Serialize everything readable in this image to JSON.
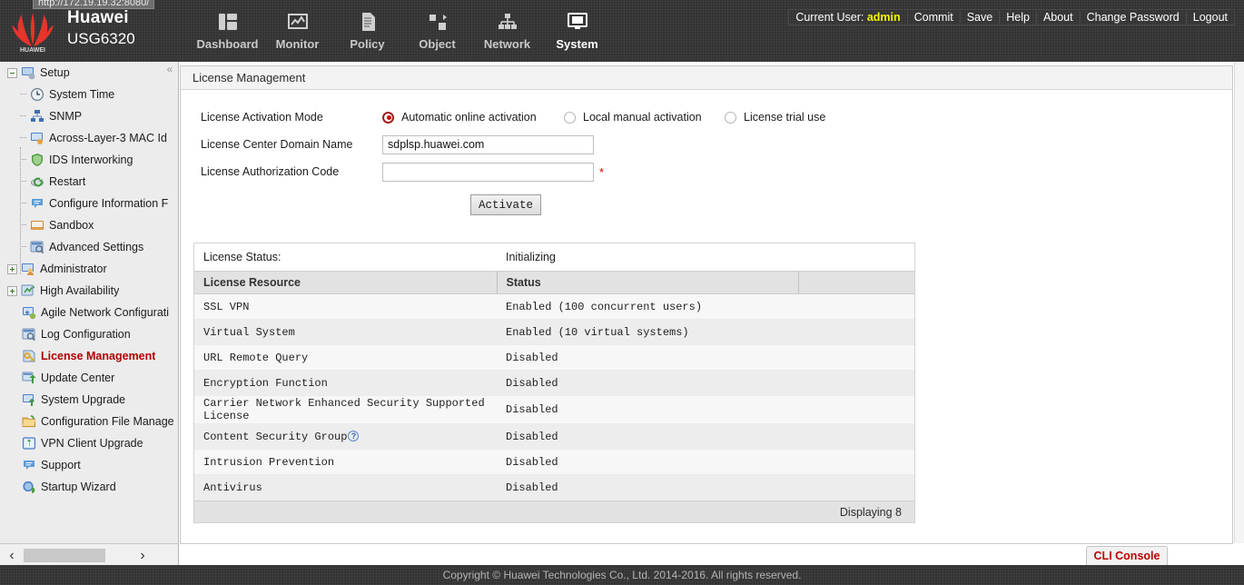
{
  "browser": {
    "url_tip": "http://172.19.19.32:8080/"
  },
  "header": {
    "brand_name": "Huawei",
    "model": "USG6320",
    "logo_text": "HUAWEI",
    "nav": [
      {
        "label": "Dashboard",
        "icon": "dashboard-icon",
        "active": false
      },
      {
        "label": "Monitor",
        "icon": "monitor-icon",
        "active": false
      },
      {
        "label": "Policy",
        "icon": "policy-icon",
        "active": false
      },
      {
        "label": "Object",
        "icon": "object-icon",
        "active": false
      },
      {
        "label": "Network",
        "icon": "network-icon",
        "active": false
      },
      {
        "label": "System",
        "icon": "system-icon",
        "active": true
      }
    ],
    "current_user_label": "Current User:",
    "current_user": "admin",
    "links": [
      "Commit",
      "Save",
      "Help",
      "About",
      "Change Password",
      "Logout"
    ]
  },
  "sidebar": {
    "items": [
      {
        "label": "Setup",
        "level": 0,
        "toggle": "minus",
        "icon": "setup-icon",
        "active": false
      },
      {
        "label": "System Time",
        "level": 1,
        "toggle": "none",
        "icon": "clock-icon",
        "active": false
      },
      {
        "label": "SNMP",
        "level": 1,
        "toggle": "none",
        "icon": "snmp-icon",
        "active": false
      },
      {
        "label": "Across-Layer-3 MAC Id",
        "level": 1,
        "toggle": "none",
        "icon": "mac-id-icon",
        "active": false
      },
      {
        "label": "IDS Interworking",
        "level": 1,
        "toggle": "none",
        "icon": "ids-shield-icon",
        "active": false
      },
      {
        "label": "Restart",
        "level": 1,
        "toggle": "none",
        "icon": "restart-icon",
        "active": false
      },
      {
        "label": "Configure Information F",
        "level": 1,
        "toggle": "none",
        "icon": "configure-info-icon",
        "active": false
      },
      {
        "label": "Sandbox",
        "level": 1,
        "toggle": "none",
        "icon": "sandbox-icon",
        "active": false
      },
      {
        "label": "Advanced Settings",
        "level": 1,
        "toggle": "none",
        "icon": "advanced-settings-icon",
        "active": false
      },
      {
        "label": "Administrator",
        "level": 0,
        "toggle": "plus",
        "icon": "administrator-icon",
        "active": false
      },
      {
        "label": "High Availability",
        "level": 0,
        "toggle": "plus",
        "icon": "high-availability-icon",
        "active": false
      },
      {
        "label": "Agile Network Configurati",
        "level": 0,
        "toggle": "none",
        "icon": "agile-network-icon",
        "active": false
      },
      {
        "label": "Log Configuration",
        "level": 0,
        "toggle": "none",
        "icon": "log-config-icon",
        "active": false
      },
      {
        "label": "License Management",
        "level": 0,
        "toggle": "none",
        "icon": "license-key-icon",
        "active": true
      },
      {
        "label": "Update Center",
        "level": 0,
        "toggle": "none",
        "icon": "update-center-icon",
        "active": false
      },
      {
        "label": "System Upgrade",
        "level": 0,
        "toggle": "none",
        "icon": "system-upgrade-icon",
        "active": false
      },
      {
        "label": "Configuration File Manage",
        "level": 0,
        "toggle": "none",
        "icon": "config-file-folder-icon",
        "active": false
      },
      {
        "label": "VPN Client Upgrade",
        "level": 0,
        "toggle": "none",
        "icon": "vpn-client-icon",
        "active": false
      },
      {
        "label": "Support",
        "level": 0,
        "toggle": "none",
        "icon": "support-icon",
        "active": false
      },
      {
        "label": "Startup Wizard",
        "level": 0,
        "toggle": "none",
        "icon": "startup-wizard-icon",
        "active": false
      }
    ],
    "collapse_glyph": "«",
    "scroll_left_glyph": "‹",
    "scroll_right_glyph": "›"
  },
  "main": {
    "panel_title": "License Management",
    "form": {
      "activation_mode_label": "License Activation Mode",
      "modes": [
        {
          "label": "Automatic online activation",
          "selected": true
        },
        {
          "label": "Local manual activation",
          "selected": false
        },
        {
          "label": "License trial use",
          "selected": false
        }
      ],
      "domain_label": "License Center Domain Name",
      "domain_value": "sdplsp.huawei.com",
      "auth_code_label": "License Authorization Code",
      "auth_code_value": "",
      "auth_code_placeholder": "",
      "required_mark": "*",
      "activate_label": "Activate"
    },
    "license": {
      "status_label": "License Status:",
      "status_value": "Initializing",
      "columns": [
        "License Resource",
        "Status",
        ""
      ],
      "rows": [
        {
          "resource": "SSL VPN",
          "status": "Enabled (100 concurrent users)",
          "help": false
        },
        {
          "resource": "Virtual System",
          "status": "Enabled (10 virtual systems)",
          "help": false
        },
        {
          "resource": "URL Remote Query",
          "status": "Disabled",
          "help": false
        },
        {
          "resource": "Encryption Function",
          "status": "Disabled",
          "help": false
        },
        {
          "resource": "Carrier Network Enhanced Security Supported License",
          "status": "Disabled",
          "help": false
        },
        {
          "resource": "Content Security Group",
          "status": "Disabled",
          "help": true
        },
        {
          "resource": "Intrusion Prevention",
          "status": "Disabled",
          "help": false
        },
        {
          "resource": "Antivirus",
          "status": "Disabled",
          "help": false
        }
      ],
      "footer_text": "Displaying 8",
      "help_glyph": "?"
    }
  },
  "bottom": {
    "cli_console_label": "CLI Console",
    "copyright": "Copyright © Huawei Technologies Co., Ltd. 2014-2016. All rights reserved."
  },
  "colors": {
    "header_bg": "#333334",
    "accent_red": "#b00000",
    "user_yellow": "#f5f500",
    "radio_red": "#cc0000"
  }
}
